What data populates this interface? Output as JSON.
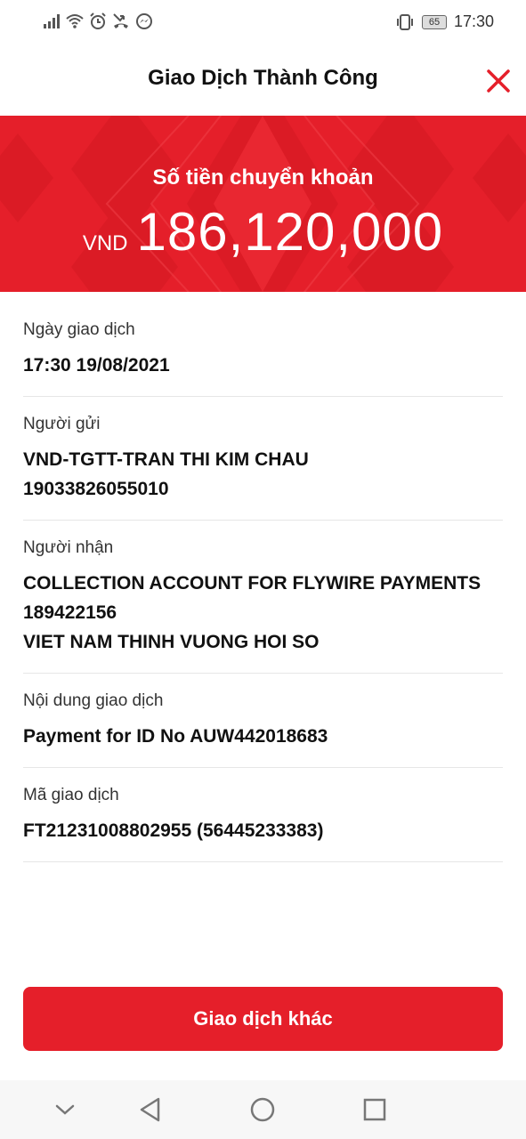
{
  "status_bar": {
    "icons": [
      "signal-icon",
      "wifi-icon",
      "alarm-icon",
      "missed-call-icon",
      "messenger-icon",
      "vibrate-icon"
    ],
    "battery": "65",
    "time": "17:30"
  },
  "header": {
    "title": "Giao Dịch Thành Công",
    "close_icon": "close-icon"
  },
  "banner": {
    "label": "Số tiền chuyển khoản",
    "currency": "VND",
    "amount": "186,120,000"
  },
  "details": [
    {
      "label": "Ngày giao dịch",
      "lines": [
        "17:30 19/08/2021"
      ]
    },
    {
      "label": "Người gửi",
      "lines": [
        "VND-TGTT-TRAN THI KIM CHAU",
        "19033826055010"
      ]
    },
    {
      "label": "Người nhận",
      "lines": [
        "COLLECTION ACCOUNT FOR FLYWIRE PAYMENTS",
        "189422156",
        "VIET NAM THINH VUONG HOI SO"
      ]
    },
    {
      "label": "Nội dung giao dịch",
      "lines": [
        "Payment for ID No AUW442018683"
      ]
    },
    {
      "label": "Mã giao dịch",
      "lines": [
        "FT21231008802955 (56445233383)"
      ]
    }
  ],
  "action_button": "Giao dịch khác",
  "nav_bar": [
    "chevron-down-icon",
    "back-icon",
    "home-icon",
    "recents-icon"
  ],
  "colors": {
    "accent": "#e51f2a"
  }
}
